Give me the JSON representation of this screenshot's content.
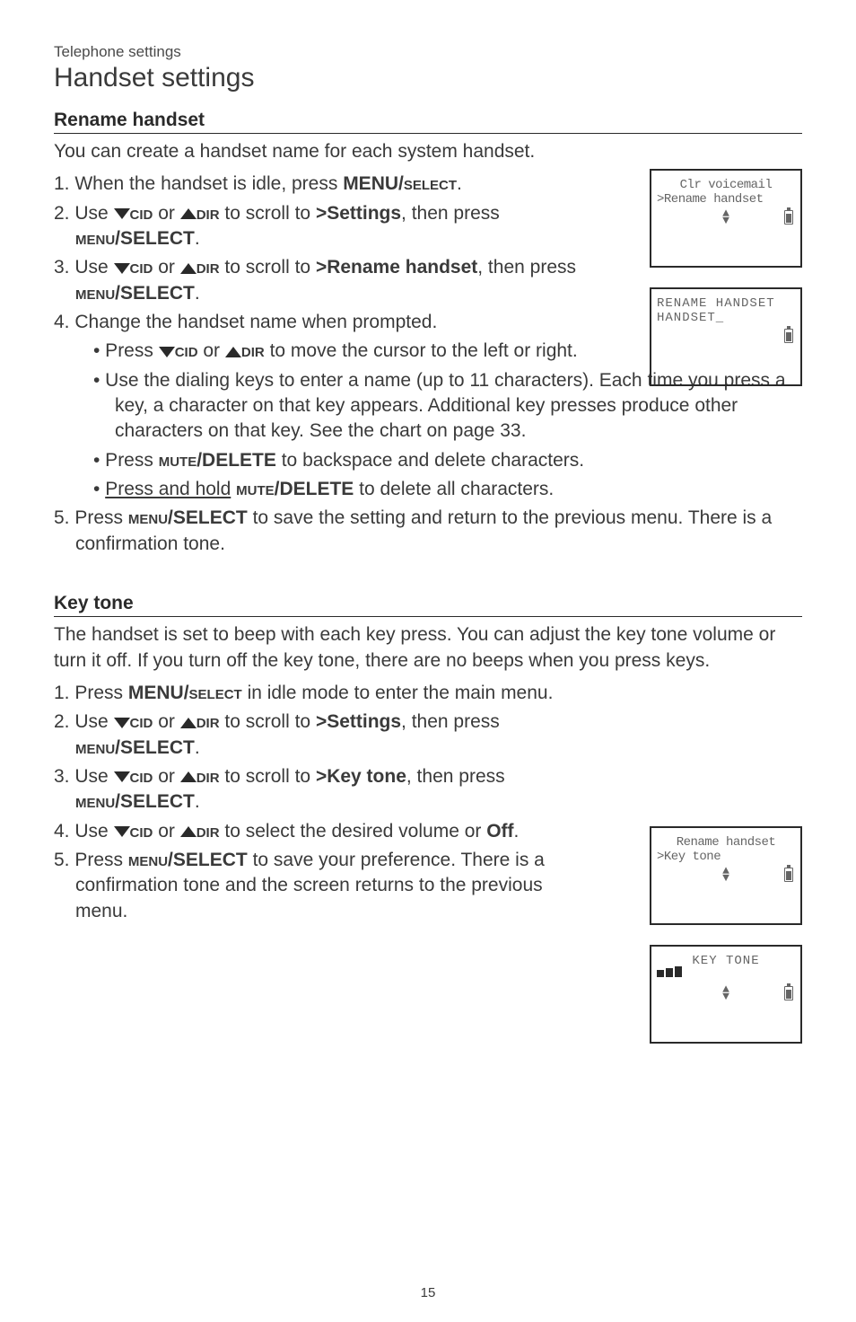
{
  "header": {
    "context": "Telephone settings",
    "title": "Handset settings"
  },
  "rename": {
    "heading": "Rename handset",
    "intro": "You can create a handset name for each system handset.",
    "step1_pre": "1. When the handset is idle, press ",
    "menu_big": "MENU/",
    "select_sc": "select",
    "period": ".",
    "step2_pre": "2. Use ",
    "cid": "cid",
    "or": " or ",
    "dir": "dir",
    "to_scroll": " to scroll to ",
    "settings": ">Settings",
    "then_press": ", then press ",
    "menu_sc": "menu",
    "select_big": "/SELECT",
    "step3_to": ">Rename handset",
    "step3_then": ", then press ",
    "step4": "4. Change the handset name when prompted.",
    "sub1_pre": "• Press ",
    "sub1_post": " to move the cursor to the left or right.",
    "sub2": "• Use the dialing keys to enter a name (up to 11 characters). Each time you press a key, a character on that key appears. Additional key presses produce other characters on that key. See the chart on page 33.",
    "sub3_pre": "• Press ",
    "mute_sc": "mute",
    "delete_big": "/DELETE",
    "sub3_post": " to backspace and delete characters.",
    "sub4_pre": "• ",
    "sub4_underline": "Press and hold",
    "sub4_mid": " ",
    "sub4_post": " to delete all characters.",
    "step5_pre": "5. Press ",
    "step5_post": " to save the setting and return to the previous menu. There is a confirmation tone."
  },
  "keytone": {
    "heading": "Key tone",
    "intro": "The handset is set to beep with each key press. You can adjust the key tone volume or turn it off. If you turn off the key tone, there are no beeps when you press keys.",
    "step1_pre": "1. Press ",
    "step1_post": " in idle mode to enter the main menu.",
    "step3_to": ">Key tone",
    "step4_pre": "4. Use ",
    "step4_mid": " to select the desired volume or ",
    "off": "Off",
    "step5_pre": "5. Press ",
    "step5_post": " to save your preference. There is a confirmation tone and the screen returns to the previous menu."
  },
  "screens": {
    "s1_line1": "Clr voicemail",
    "s1_line2": ">Rename handset",
    "s2_line1": "RENAME HANDSET",
    "s2_line2": "HANDSET_",
    "s3_line1": "Rename handset",
    "s3_line2": ">Key tone",
    "s4_line1": "KEY TONE"
  },
  "page": "15"
}
